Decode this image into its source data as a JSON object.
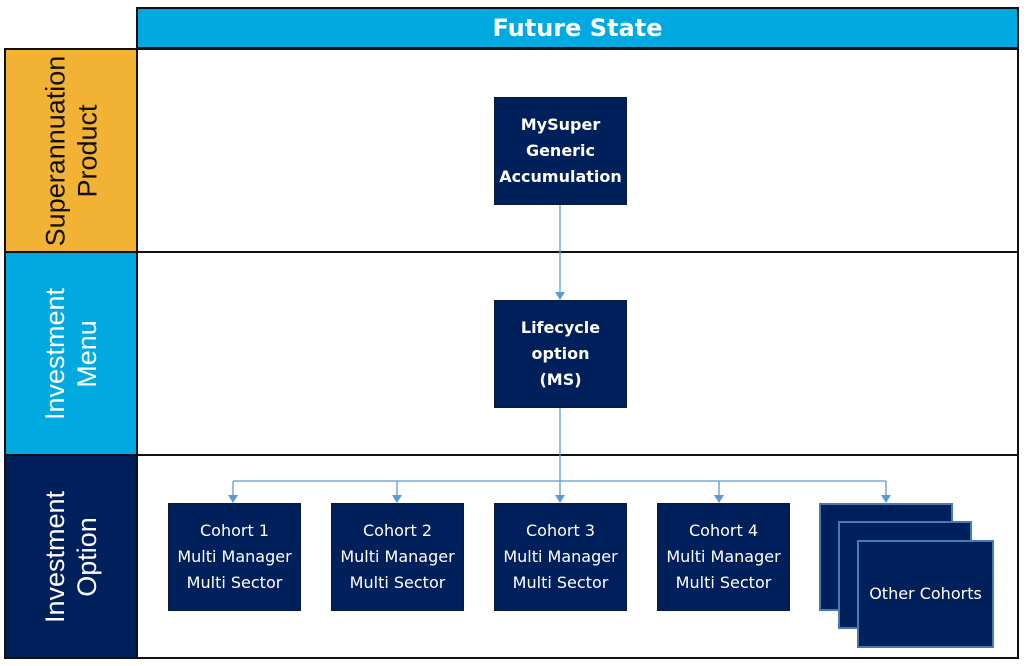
{
  "title": "Future State",
  "lanes": [
    {
      "label": "Superannuation\nProduct",
      "color": "#f2b233",
      "text_color": "#111111"
    },
    {
      "label": "Investment\nMenu",
      "color": "#00a9e0",
      "text_color": "#ffffff"
    },
    {
      "label": "Investment\nOption",
      "color": "#00205b",
      "text_color": "#ffffff"
    }
  ],
  "nodes": {
    "product": "MySuper\nGeneric\nAccumulation",
    "menu": "Lifecycle\noption\n(MS)",
    "cohorts": [
      "Cohort 1\nMulti Manager\nMulti Sector",
      "Cohort 2\nMulti Manager\nMulti Sector",
      "Cohort 3\nMulti Manager\nMulti Sector",
      "Cohort 4\nMulti Manager\nMulti Sector"
    ],
    "other": "Other Cohorts"
  },
  "colors": {
    "box": "#00205b",
    "connector": "#5b9bd5",
    "header": "#00a9e0"
  }
}
